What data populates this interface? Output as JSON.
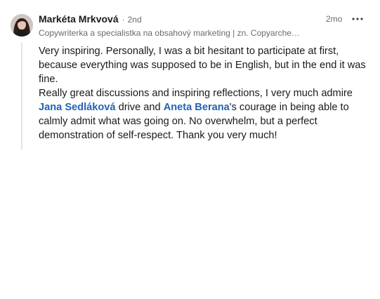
{
  "comment": {
    "author": {
      "name": "Markéta Mrkvová",
      "separator": "·",
      "degree": "2nd",
      "headline": "Copywriterka a specialistka na obsahový marketing | zn. Copyarche…"
    },
    "timestamp": "2mo",
    "more_icon": "ellipsis-icon",
    "body": {
      "paragraph1": "Very inspiring. Personally, I was a bit hesitant to participate at first, because everything was supposed to be in English, but in the end it was fine.",
      "p2_part1": "Really great discussions and inspiring reflections, I very much admire ",
      "mention1": "Jana Sedláková",
      "p2_part2": " drive and ",
      "mention2": "Aneta Berana",
      "p2_part3": "'s courage in being able to calmly admit what was going on. No overwhelm, but a perfect demonstration of self-respect. Thank you very much!"
    },
    "colors": {
      "mention": "#2463b4",
      "meta_text": "#6b6b6b",
      "thread_line": "#e4e4e4"
    }
  }
}
